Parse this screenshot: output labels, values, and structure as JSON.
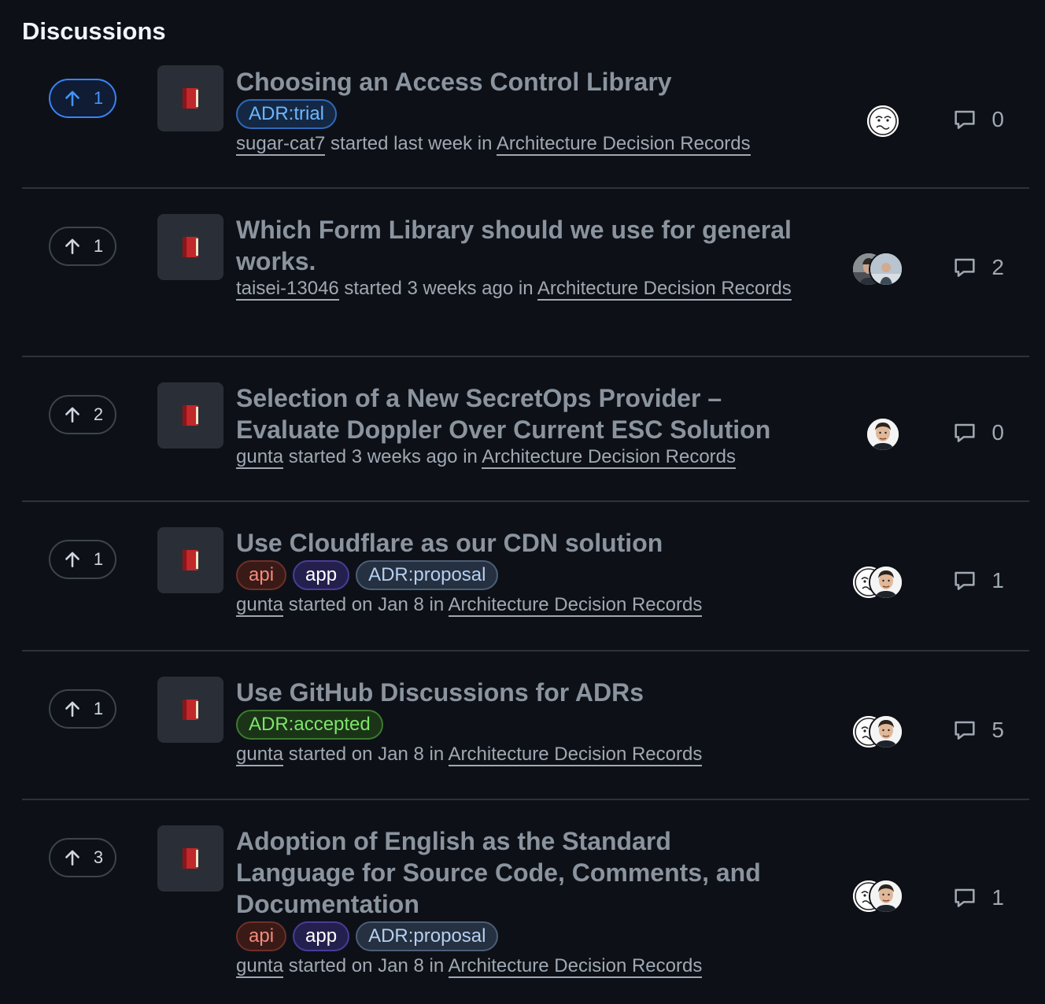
{
  "page": {
    "title": "Discussions"
  },
  "discussions": [
    {
      "votes": "1",
      "voted": true,
      "title": "Choosing an Access Control Library",
      "labels": [
        "ADR:trial"
      ],
      "author": "sugar-cat7",
      "when": "started last week in",
      "category": "Architecture Decision Records",
      "comments": "0",
      "participants": [
        "sketch"
      ]
    },
    {
      "votes": "1",
      "voted": false,
      "title": "Which Form Library should we use for general works.",
      "labels": [],
      "author": "taisei-13046",
      "when": "started 3 weeks ago in",
      "category": "Architecture Decision Records",
      "comments": "2",
      "participants": [
        "photo-a",
        "photo-b"
      ]
    },
    {
      "votes": "2",
      "voted": false,
      "title": "Selection of a New SecretOps Provider – Evaluate Doppler Over Current ESC Solution",
      "labels": [],
      "author": "gunta",
      "when": "started 3 weeks ago in",
      "category": "Architecture Decision Records",
      "comments": "0",
      "participants": [
        "portrait"
      ]
    },
    {
      "votes": "1",
      "voted": false,
      "title": "Use Cloudflare as our CDN solution",
      "labels": [
        "api",
        "app",
        "ADR:proposal"
      ],
      "author": "gunta",
      "when": "started on Jan 8 in",
      "category": "Architecture Decision Records",
      "comments": "1",
      "participants": [
        "sketch",
        "portrait"
      ]
    },
    {
      "votes": "1",
      "voted": false,
      "title": "Use GitHub Discussions for ADRs",
      "labels": [
        "ADR:accepted"
      ],
      "author": "gunta",
      "when": "started on Jan 8 in",
      "category": "Architecture Decision Records",
      "comments": "5",
      "participants": [
        "sketch",
        "portrait"
      ]
    },
    {
      "votes": "3",
      "voted": false,
      "title": "Adoption of English as the Standard Language for Source Code, Comments, and Documentation",
      "labels": [
        "api",
        "app",
        "ADR:proposal"
      ],
      "author": "gunta",
      "when": "started on Jan 8 in",
      "category": "Architecture Decision Records",
      "comments": "1",
      "participants": [
        "sketch",
        "portrait"
      ]
    }
  ],
  "icons": {
    "upvote": "arrow-up-icon",
    "comment": "comment-icon",
    "category": "book-emoji-icon"
  },
  "colors": {
    "background": "#0d1117",
    "accent": "#4493f8",
    "divider": "#2d333b"
  }
}
